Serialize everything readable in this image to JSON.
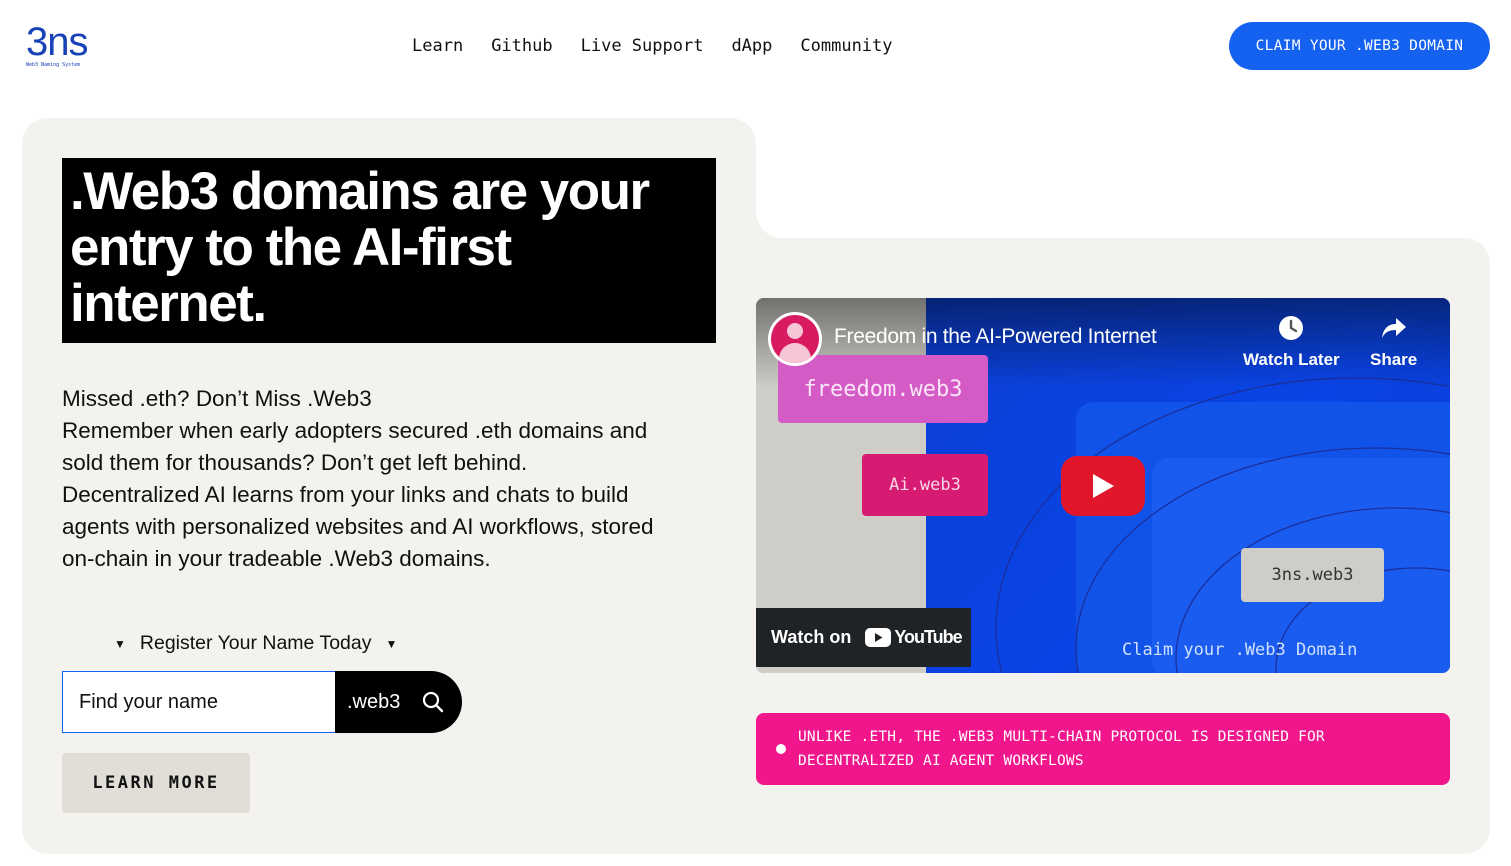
{
  "header": {
    "logo_text": "3ns",
    "logo_tagline": "Web3 Naming System",
    "nav": [
      "Learn",
      "Github",
      "Live Support",
      "dApp",
      "Community"
    ],
    "cta_label": "CLAIM YOUR .WEB3 DOMAIN"
  },
  "hero": {
    "title": ".Web3 domains are your entry to the AI-first internet.",
    "subtitle": "Missed .eth? Don’t Miss .Web3",
    "description": "Remember when early adopters secured .eth domains and sold them for thousands? Don’t get left behind. Decentralized AI learns from your links and chats to build agents with personalized websites and AI workflows, stored on-chain in your tradeable .Web3 domains.",
    "register_label": "Register Your Name Today",
    "search_placeholder": "Find your name",
    "search_suffix": ".web3",
    "learn_more_label": "LEARN MORE"
  },
  "video": {
    "title": "Freedom in the AI-Powered Internet",
    "watch_later_label": "Watch Later",
    "share_label": "Share",
    "tag_freedom": "freedom.web3",
    "tag_ai": "Ai.web3",
    "tag_3ns": "3ns.web3",
    "claim_text": "Claim your .Web3 Domain",
    "watch_on_label": "Watch on",
    "youtube_label": "YouTube"
  },
  "banner": {
    "text": "UNLIKE .ETH, THE .WEB3 MULTI-CHAIN PROTOCOL IS DESIGNED FOR DECENTRALIZED AI AGENT WORKFLOWS"
  },
  "colors": {
    "brand_blue": "#1561f0",
    "logo_blue": "#1742b8",
    "panel_bg": "#f3f2ee",
    "banner_pink": "#f2168c",
    "youtube_red": "#e2162b"
  },
  "icons": [
    "search-icon",
    "clock-icon",
    "share-arrow-icon",
    "play-icon",
    "youtube-play-icon",
    "triangle-down-icon",
    "bullet-dot-icon"
  ]
}
